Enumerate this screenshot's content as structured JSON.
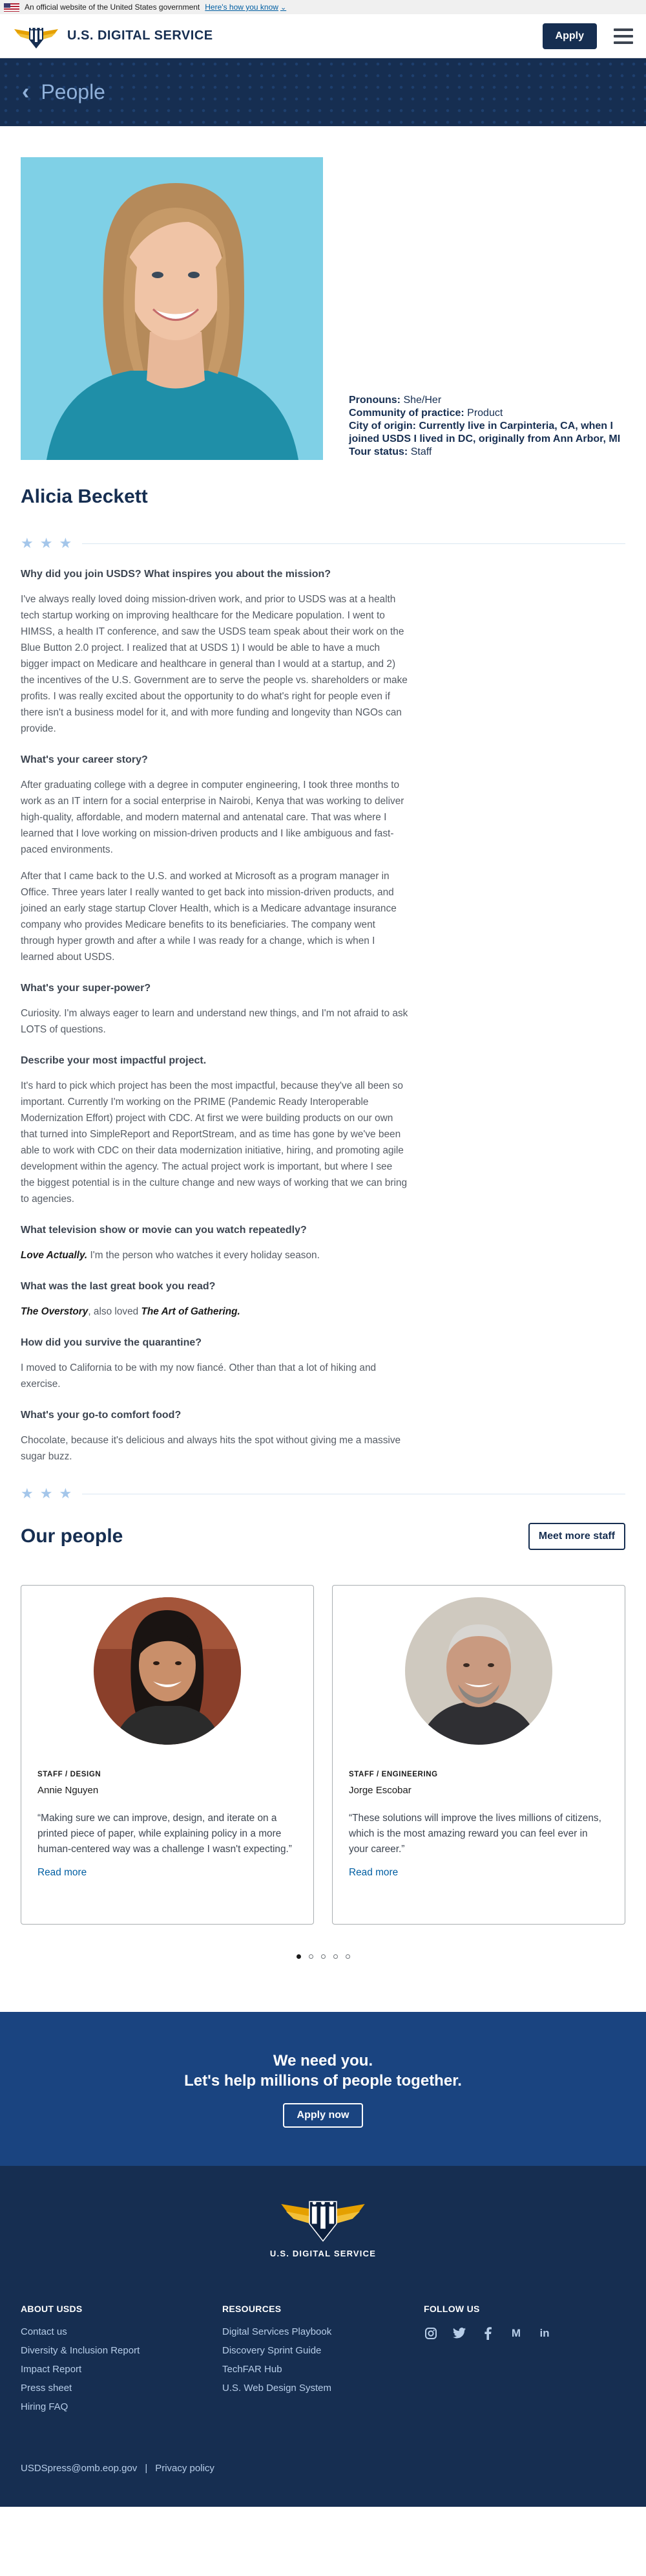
{
  "gov_banner": {
    "text": "An official website of the United States government",
    "link": "Here's how you know",
    "chevron": "chevron-down-icon"
  },
  "header": {
    "brand": "U.S. DIGITAL SERVICE",
    "apply": "Apply",
    "menu_icon": "hamburger-menu-icon"
  },
  "hero": {
    "back_icon": "chevron-left-icon",
    "title": "People"
  },
  "profile": {
    "pronouns_label": "Pronouns:",
    "pronouns": "She/Her",
    "community_label": "Community of practice:",
    "community": "Product",
    "city_label": "City of origin:",
    "city": "Currently live in Carpinteria, CA, when I joined USDS I lived in DC, originally from Ann Arbor, MI",
    "tour_label": "Tour status:",
    "tour": "Staff",
    "name": "Alicia Beckett"
  },
  "qa": [
    {
      "q": "Why did you join USDS? What inspires you about the mission?",
      "a": [
        "I've always really loved doing mission-driven work, and prior to USDS was at a health tech startup working on improving healthcare for the Medicare population. I went to HIMSS, a health IT conference, and saw the USDS team speak about their work on the Blue Button 2.0 project. I realized that at USDS 1) I would be able to have a much bigger impact on Medicare and healthcare in general than I would at a startup, and 2) the incentives of the U.S. Government are to serve the people vs. shareholders or make profits. I was really excited about the opportunity to do what's right for people even if there isn't a business model for it, and with more funding and longevity than NGOs can provide."
      ]
    },
    {
      "q": "What's your career story?",
      "a": [
        "After graduating college with a degree in computer engineering, I took three months to work as an IT intern for a social enterprise in Nairobi, Kenya that was working to deliver high-quality, affordable, and modern maternal and antenatal care. That was where I learned that I love working on mission-driven products and I like ambiguous and fast-paced environments.",
        "After that I came back to the U.S. and worked at Microsoft as a program manager in Office. Three years later I really wanted to get back into mission-driven products, and joined an early stage startup Clover Health, which is a Medicare advantage insurance company who provides Medicare benefits to its beneficiaries. The company went through hyper growth and after a while I was ready for a change, which is when I learned about USDS."
      ]
    },
    {
      "q": "What's your super-power?",
      "a": [
        "Curiosity. I'm always eager to learn and understand new things, and I'm not afraid to ask LOTS of questions."
      ]
    },
    {
      "q": "Describe your most impactful project.",
      "a": [
        "It's hard to pick which project has been the most impactful, because they've all been so important. Currently I'm working on the PRIME (Pandemic Ready Interoperable Modernization Effort) project with CDC. At first we were building products on our own that turned into SimpleReport and ReportStream, and as time has gone by we've been able to work with CDC on their data modernization initiative, hiring, and promoting agile development within the agency. The actual project work is important, but where I see the biggest potential is in the culture change and new ways of working that we can bring to agencies."
      ]
    },
    {
      "q": "What television show or movie can you watch repeatedly?",
      "a_em": "Love Actually.",
      "a_rest": " I'm the person who watches it every holiday season."
    },
    {
      "q": "What was the last great book you read?",
      "a_em": "The Overstory",
      "a_mid": ", also loved ",
      "a_em2": "The Art of Gathering."
    },
    {
      "q": "How did you survive the quarantine?",
      "a": [
        "I moved to California to be with my now fiancé. Other than that a lot of hiking and exercise."
      ]
    },
    {
      "q": "What's your go-to comfort food?",
      "a": [
        "Chocolate, because it's delicious and always hits the spot without giving me a massive sugar buzz."
      ]
    }
  ],
  "people": {
    "title": "Our people",
    "meet_more": "Meet more staff",
    "cards": [
      {
        "role": "STAFF / DESIGN",
        "name": "Annie Nguyen",
        "quote": "“Making sure we can improve, design, and iterate on a printed piece of paper, while explaining policy in a more human-centered way was a challenge I wasn't expecting.”",
        "link": "Read more"
      },
      {
        "role": "STAFF / ENGINEERING",
        "name": "Jorge Escobar",
        "quote": "“These solutions will improve the lives millions of citizens, which is the most amazing reward you can feel ever in your career.”",
        "link": "Read more"
      }
    ],
    "active_dot": 1,
    "dot_count": 5
  },
  "cta": {
    "line1": "We need you.",
    "line2": "Let's help millions of people together.",
    "button": "Apply now"
  },
  "footer": {
    "brand": "U.S. DIGITAL SERVICE",
    "about": {
      "title": "ABOUT USDS",
      "links": [
        "Contact us",
        "Diversity & Inclusion Report",
        "Impact Report",
        "Press sheet",
        "Hiring FAQ"
      ]
    },
    "resources": {
      "title": "RESOURCES",
      "links": [
        "Digital Services Playbook",
        "Discovery Sprint Guide",
        "TechFAR Hub",
        "U.S. Web Design System"
      ]
    },
    "follow": {
      "title": "FOLLOW US",
      "icons": [
        "instagram-icon",
        "twitter-icon",
        "facebook-icon",
        "medium-icon",
        "linkedin-icon"
      ]
    },
    "email": "USDSpress@omb.eop.gov",
    "separator": "|",
    "privacy": "Privacy policy"
  },
  "colors": {
    "navy": "#162e51",
    "blue": "#1a4480",
    "link": "#005ea2"
  }
}
